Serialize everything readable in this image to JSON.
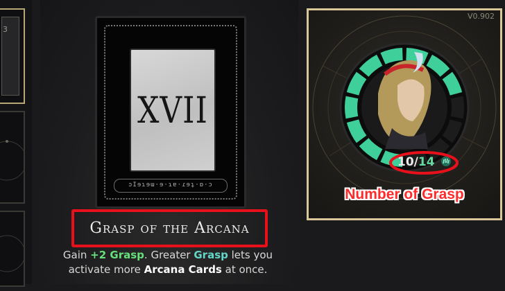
{
  "left_column": {
    "slot_count": "3"
  },
  "card": {
    "numeral": "XVII",
    "script_text": "ↄIɘɿɘɯ·ɘ·ɿɐ·ɾɘʇ·ɒ·ɔ",
    "title": "Grasp of the Arcana",
    "description": {
      "part1": "Gain ",
      "bonus": "+2 Grasp",
      "part2": ". Greater ",
      "keyword1": "Grasp",
      "part3": " lets you activate more ",
      "keyword2": "Arcana Cards",
      "part4": " at once."
    }
  },
  "status_panel": {
    "version": "V0.902",
    "grasp_current": "10",
    "grasp_separator": "/",
    "grasp_max": "14",
    "grasp_ratio": 0.714,
    "annotation": "Number of Grasp"
  },
  "colors": {
    "highlight_red": "#e8101a",
    "grasp_green": "#3fcf9b",
    "panel_gold": "#d9c79a"
  }
}
